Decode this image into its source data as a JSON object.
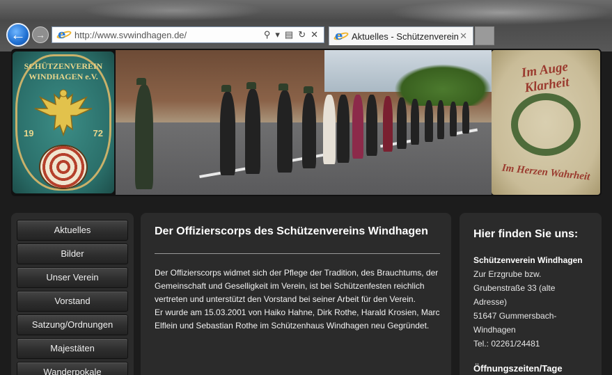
{
  "browser": {
    "url": "http://www.svwindhagen.de/",
    "tab_title": "Aktuelles - Schützenverein ...",
    "icons": {
      "back": "back-arrow-icon",
      "forward": "forward-arrow-icon",
      "site": "internet-explorer-icon",
      "search": "search-icon",
      "compat": "compatibility-view-icon",
      "refresh": "refresh-icon",
      "stop": "close-icon"
    }
  },
  "banner": {
    "crest_text": "SCHÜTZENVEREIN WINDHAGEN e.V.",
    "crest_year_left": "19",
    "crest_year_right": "72",
    "motto_top": "Im Auge Klarheit",
    "motto_bottom": "Im Herzen Wahrheit"
  },
  "nav": {
    "items": [
      {
        "label": "Aktuelles"
      },
      {
        "label": "Bilder"
      },
      {
        "label": "Unser Verein"
      },
      {
        "label": "Vorstand"
      },
      {
        "label": "Satzung/Ordnungen"
      },
      {
        "label": "Majestäten"
      },
      {
        "label": "Wanderpokale"
      }
    ]
  },
  "main": {
    "title": "Der Offizierscorps des Schützenvereins Windhagen",
    "paragraph1": "Der Offizierscorps widmet sich der Pflege der Tradition, des Brauchtums, der Gemeinschaft und Geselligkeit im Verein, ist bei Schützenfesten reichlich vertreten und unterstützt den Vorstand bei seiner Arbeit für den Verein.",
    "paragraph2": "Er wurde am 15.03.2001 von Haiko Hahne, Dirk Rothe, Harald Krosien, Marc Elflein und Sebastian Rothe im Schützenhaus Windhagen neu Gegründet."
  },
  "side": {
    "title": "Hier finden Sie uns:",
    "org": "Schützenverein Windhagen",
    "lines": [
      "Zur Erzgrube bzw.",
      "Grubenstraße 33 (alte",
      "Adresse)",
      "51647 Gummersbach-",
      "Windhagen",
      "Tel.: 02261/24481"
    ],
    "subtitle": "Öffnungszeiten/Tage"
  },
  "colors": {
    "page_bg": "#1c1c1c",
    "panel_bg": "#2b2b2b",
    "text": "#ffffff",
    "crest_green": "#2a6e69",
    "motto_red": "#9a3a2e"
  }
}
